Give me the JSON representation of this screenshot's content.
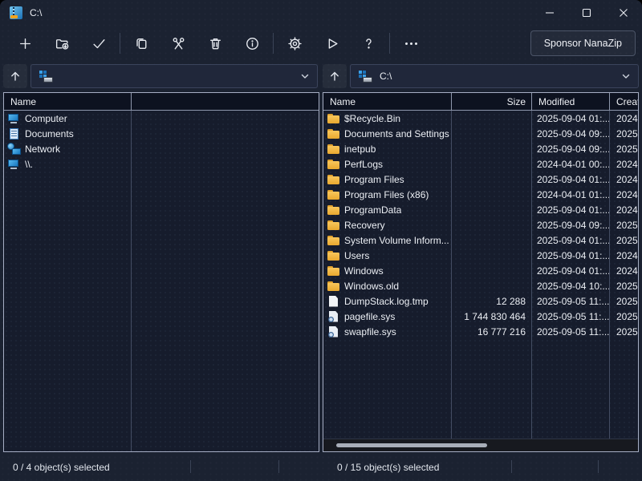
{
  "window": {
    "title": "C:\\"
  },
  "toolbar": {
    "icons": [
      "plus",
      "extract-folder",
      "checkmark",
      "copy",
      "scissors",
      "trash",
      "info",
      "gear",
      "play",
      "question-mark",
      "ellipsis"
    ],
    "sponsor_label": "Sponsor NanaZip"
  },
  "colors": {
    "window_bg": "#1b2231",
    "panel_bg": "#161c2c",
    "header_bg": "#0d1220",
    "panel_border": "#a6aec4",
    "folder_icon": "#f0b13e",
    "text": "#eceff4"
  },
  "left_panel": {
    "address_value": "",
    "columns": [
      "Name",
      ""
    ],
    "items": [
      {
        "name": "Computer",
        "icon": "computer"
      },
      {
        "name": "Documents",
        "icon": "documents"
      },
      {
        "name": "Network",
        "icon": "network"
      },
      {
        "name": "\\\\.",
        "icon": "computer"
      }
    ],
    "status": "0 / 4 object(s) selected"
  },
  "right_panel": {
    "address_value": "C:\\",
    "columns": [
      "Name",
      "Size",
      "Modified",
      "Created"
    ],
    "items": [
      {
        "name": "$Recycle.Bin",
        "icon": "folder",
        "size": "",
        "modified": "2025-09-04 01:...",
        "created": "2024-"
      },
      {
        "name": "Documents and Settings",
        "icon": "folder",
        "size": "",
        "modified": "2025-09-04 09:...",
        "created": "2025-"
      },
      {
        "name": "inetpub",
        "icon": "folder",
        "size": "",
        "modified": "2025-09-04 09:...",
        "created": "2025-"
      },
      {
        "name": "PerfLogs",
        "icon": "folder",
        "size": "",
        "modified": "2024-04-01 00:...",
        "created": "2024-"
      },
      {
        "name": "Program Files",
        "icon": "folder",
        "size": "",
        "modified": "2025-09-04 01:...",
        "created": "2024-"
      },
      {
        "name": "Program Files (x86)",
        "icon": "folder",
        "size": "",
        "modified": "2024-04-01 01:...",
        "created": "2024-"
      },
      {
        "name": "ProgramData",
        "icon": "folder",
        "size": "",
        "modified": "2025-09-04 01:...",
        "created": "2024-"
      },
      {
        "name": "Recovery",
        "icon": "folder",
        "size": "",
        "modified": "2025-09-04 09:...",
        "created": "2025-"
      },
      {
        "name": "System Volume Inform...",
        "icon": "folder",
        "size": "",
        "modified": "2025-09-04 01:...",
        "created": "2025-"
      },
      {
        "name": "Users",
        "icon": "folder",
        "size": "",
        "modified": "2025-09-04 01:...",
        "created": "2024-"
      },
      {
        "name": "Windows",
        "icon": "folder",
        "size": "",
        "modified": "2025-09-04 01:...",
        "created": "2024-"
      },
      {
        "name": "Windows.old",
        "icon": "folder",
        "size": "",
        "modified": "2025-09-04 10:...",
        "created": "2025-"
      },
      {
        "name": "DumpStack.log.tmp",
        "icon": "file",
        "size": "12 288",
        "modified": "2025-09-05 11:...",
        "created": "2025-"
      },
      {
        "name": "pagefile.sys",
        "icon": "file-sys",
        "size": "1 744 830 464",
        "modified": "2025-09-05 11:...",
        "created": "2025-"
      },
      {
        "name": "swapfile.sys",
        "icon": "file-sys",
        "size": "16 777 216",
        "modified": "2025-09-05 11:...",
        "created": "2025-"
      }
    ],
    "status": "0 / 15 object(s) selected"
  }
}
